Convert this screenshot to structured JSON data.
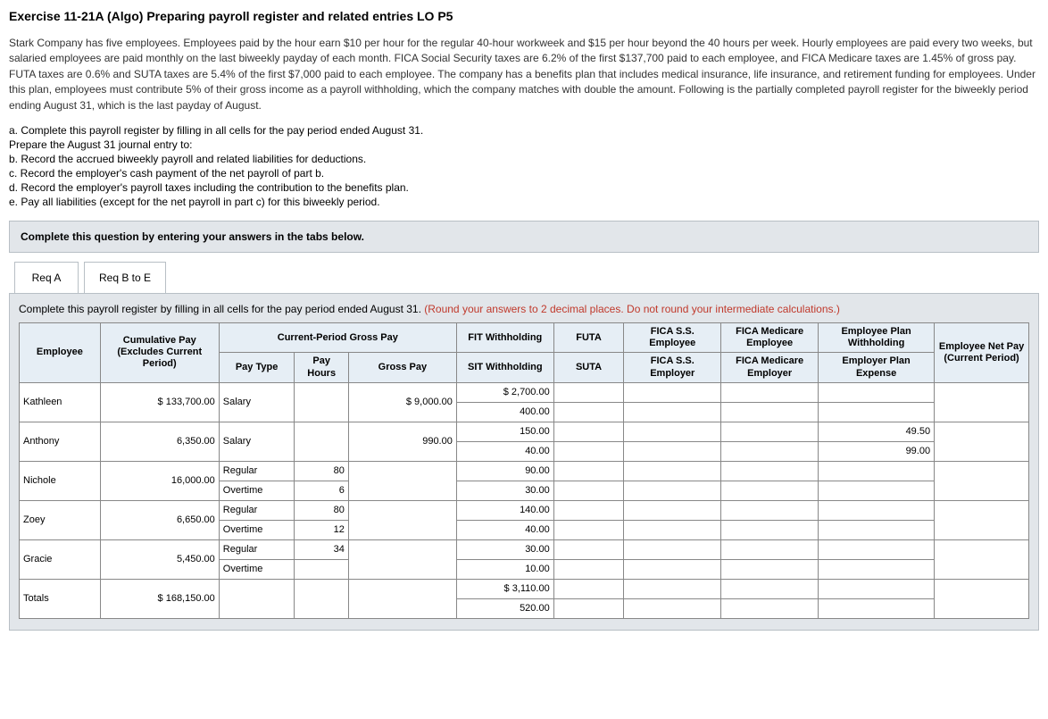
{
  "title": "Exercise 11-21A (Algo) Preparing payroll register and related entries LO P5",
  "para1": "Stark Company has five employees. Employees paid by the hour earn $10 per hour for the regular 40-hour workweek and $15 per hour beyond the 40 hours per week. Hourly employees are paid every two weeks, but salaried employees are paid monthly on the last biweekly payday of each month. FICA Social Security taxes are 6.2% of the first $137,700 paid to each employee, and FICA Medicare taxes are 1.45% of gross pay. FUTA taxes are 0.6% and SUTA taxes are 5.4% of the first $7,000 paid to each employee. The company has a benefits plan that includes medical insurance, life insurance, and retirement funding for employees. Under this plan, employees must contribute 5% of their gross income as a payroll withholding, which the company matches with double the amount. Following is the partially completed payroll register for the biweekly period ending August 31, which is the last payday of August.",
  "bullets": {
    "a": "a. Complete this payroll register by filling in all cells for the pay period ended August 31.",
    "prep": "Prepare the August 31 journal entry to:",
    "b": "b. Record the accrued biweekly payroll and related liabilities for deductions.",
    "c": "c. Record the employer's cash payment of the net payroll of part b.",
    "d": "d. Record the employer's payroll taxes including the contribution to the benefits plan.",
    "e": "e. Pay all liabilities (except for the net payroll in part c) for this biweekly period."
  },
  "instr_box": "Complete this question by entering your answers in the tabs below.",
  "tabs": {
    "a": "Req A",
    "b": "Req B to E"
  },
  "panel_instr_main": "Complete this payroll register by filling in all cells for the pay period ended August 31. ",
  "panel_instr_red": "(Round your answers to 2 decimal places. Do not round your intermediate calculations.)",
  "headers": {
    "employee": "Employee",
    "cumulative": "Cumulative Pay (Excludes Current Period)",
    "current_period": "Current-Period Gross Pay",
    "pay_type": "Pay Type",
    "pay_hours": "Pay Hours",
    "gross_pay": "Gross Pay",
    "fit": "FIT Withholding",
    "sit": "SIT Withholding",
    "futa": "FUTA",
    "suta": "SUTA",
    "fica_ss_emp": "FICA S.S. Employee",
    "fica_ss_er": "FICA S.S. Employer",
    "fica_med_emp": "FICA Medicare Employee",
    "fica_med_er": "FICA Medicare Employer",
    "plan_emp_wh": "Employee Plan Withholding",
    "plan_er_exp": "Employer Plan Expense",
    "net_pay": "Employee Net Pay (Current Period)"
  },
  "rows": {
    "kathleen": {
      "name": "Kathleen",
      "cum": "$   133,700.00",
      "pt": "Salary",
      "ph_reg": "",
      "gp": "$      9,000.00",
      "fit": "$ 2,700.00",
      "sit": "400.00"
    },
    "anthony": {
      "name": "Anthony",
      "cum": "6,350.00",
      "pt": "Salary",
      "gp": "990.00",
      "fit": "150.00",
      "sit": "40.00",
      "plan_emp": "49.50",
      "plan_er": "99.00"
    },
    "nichole": {
      "name": "Nichole",
      "cum": "16,000.00",
      "pt_reg": "Regular",
      "ph_reg": "80",
      "pt_ot": "Overtime",
      "ph_ot": "6",
      "fit": "90.00",
      "sit": "30.00"
    },
    "zoey": {
      "name": "Zoey",
      "cum": "6,650.00",
      "pt_reg": "Regular",
      "ph_reg": "80",
      "pt_ot": "Overtime",
      "ph_ot": "12",
      "fit": "140.00",
      "sit": "40.00"
    },
    "gracie": {
      "name": "Gracie",
      "cum": "5,450.00",
      "pt_reg": "Regular",
      "ph_reg": "34",
      "pt_ot": "Overtime",
      "ph_ot": "",
      "fit": "30.00",
      "sit": "10.00"
    },
    "totals": {
      "name": "Totals",
      "cum": "$   168,150.00",
      "fit": "$ 3,110.00",
      "sit": "520.00"
    }
  }
}
